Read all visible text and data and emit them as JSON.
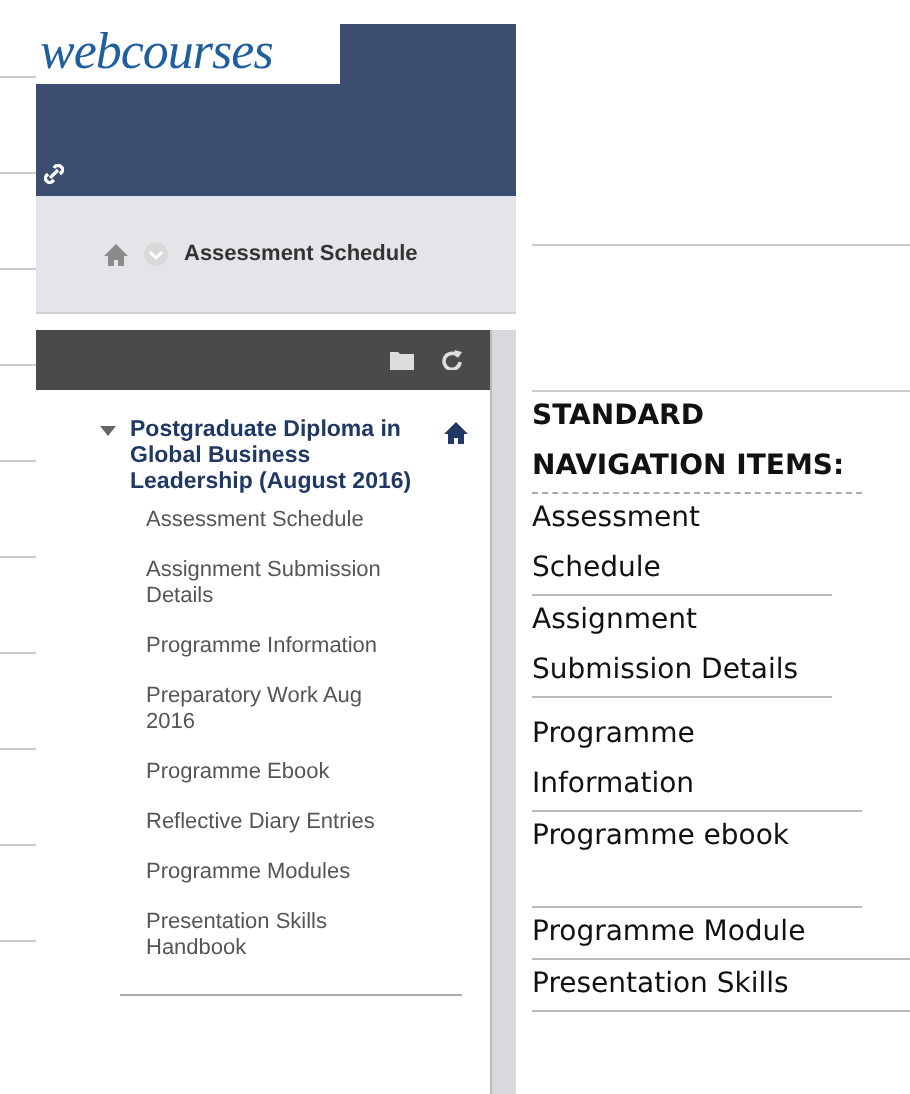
{
  "header": {
    "logo": "webcourses"
  },
  "breadcrumb": {
    "current": "Assessment Schedule"
  },
  "course_menu": {
    "root": {
      "label": "Postgraduate Diploma in Global Business Leadership (August 2016)",
      "expanded": true,
      "children": [
        {
          "label": "Assessment Schedule"
        },
        {
          "label": "Assignment Submission Details"
        },
        {
          "label": "Programme Information"
        },
        {
          "label": "Preparatory Work Aug 2016"
        },
        {
          "label": "Programme Ebook"
        },
        {
          "label": "Reflective Diary Entries"
        },
        {
          "label": "Programme Modules"
        },
        {
          "label": "Presentation Skills Handbook"
        }
      ]
    }
  },
  "content_table": {
    "heading": "STANDARD NAVIGATION ITEMS:",
    "rows": [
      {
        "text": "Assessment Schedule"
      },
      {
        "text": "Assignment Submission Details"
      },
      {
        "text": "Programme Information"
      },
      {
        "text": "Programme ebook"
      },
      {
        "text": "Programme Module"
      },
      {
        "text": "Presentation  Skills"
      }
    ]
  }
}
